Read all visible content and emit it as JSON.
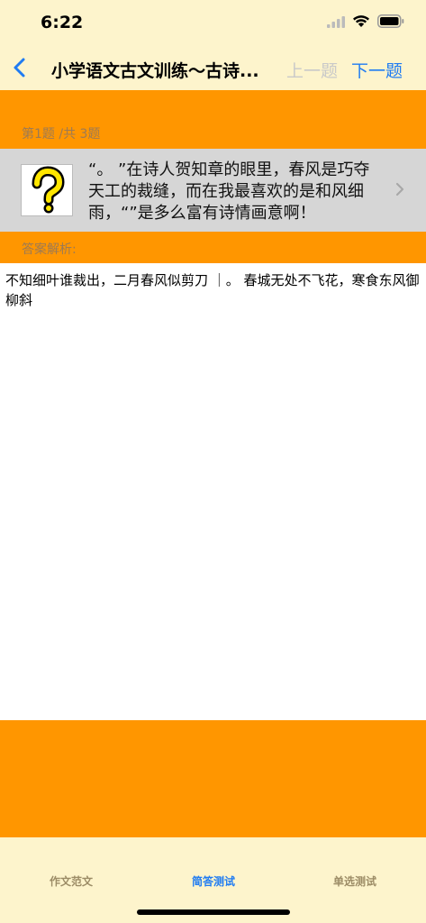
{
  "status_bar": {
    "time": "6:22",
    "icons": [
      "signal-icon",
      "wifi-icon",
      "battery-icon"
    ]
  },
  "nav": {
    "back_icon": "chevron-left-icon",
    "title": "小学语文古文训练～古诗...",
    "prev_label": "上一题",
    "next_label": "下一题"
  },
  "question": {
    "progress": "第1题 /共 3题",
    "icon": "question-mark-icon",
    "text": "“。 ”在诗人贺知章的眼里，春风是巧夺天工的裁缝，而在我最喜欢的是和风细雨，“”是多么富有诗情画意啊！",
    "chevron_icon": "chevron-right-icon"
  },
  "answer": {
    "label": "答案解析:",
    "text": "不知细叶谁裁出，二月春风似剪刀 ｜。 春城无处不飞花，寒食东风御柳斜"
  },
  "tabs": [
    {
      "label": "作文范文",
      "selected": false
    },
    {
      "label": "简答测试",
      "selected": true
    },
    {
      "label": "单选测试",
      "selected": false
    }
  ],
  "colors": {
    "accent": "#ff9600",
    "bar_background": "#fdf4cc",
    "link_blue": "#1f7bf2",
    "disabled_gray": "#c9c9c9"
  }
}
